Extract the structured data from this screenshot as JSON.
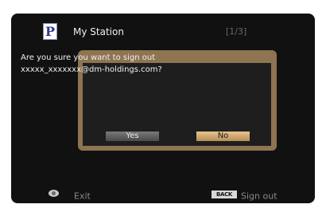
{
  "header": {
    "app_icon": "P",
    "title": "My Station",
    "page_indicator": "[1/3]"
  },
  "dialog": {
    "message_line1": "Are you sure you want to sign out",
    "message_line2": "xxxxx_xxxxxxx@dm-holdings.com?",
    "yes_label": "Yes",
    "no_label": "No",
    "selected": "No"
  },
  "footer": {
    "exit_icon": "remote-option-button-icon",
    "exit_label": "Exit",
    "back_key": "BACK",
    "signout_label": "Sign out"
  },
  "colors": {
    "screen_bg": "#111111",
    "dialog_frame": "#8e7451",
    "selected_button": "#d4ac72",
    "unselected_button": "#5e5e5e"
  }
}
